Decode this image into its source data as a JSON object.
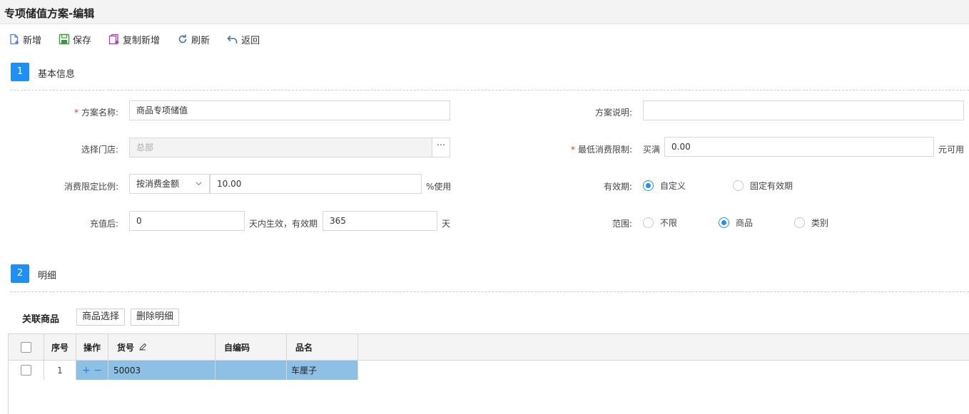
{
  "page": {
    "title": "专项储值方案-编辑"
  },
  "toolbar": {
    "new_label": "新增",
    "save_label": "保存",
    "copy_new_label": "复制新增",
    "refresh_label": "刷新",
    "back_label": "返回"
  },
  "section1": {
    "num": "1",
    "title": "基本信息"
  },
  "form": {
    "plan_name_label": "方案名称:",
    "plan_name_value": "商品专项储值",
    "plan_desc_label": "方案说明:",
    "plan_desc_value": "",
    "store_label": "选择门店:",
    "store_value": "总部",
    "store_more": "···",
    "min_consume_label": "最低消费限制:",
    "min_consume_prefix": "买满",
    "min_consume_value": "0.00",
    "min_consume_suffix": "元可用",
    "ratio_label": "消费限定比例:",
    "ratio_select": "按消费金额",
    "ratio_value": "10.00",
    "ratio_suffix": "%使用",
    "validity_label": "有效期:",
    "validity_options": [
      "自定义",
      "固定有效期"
    ],
    "validity_selected": 0,
    "recharge_label": "充值后:",
    "recharge_value": "0",
    "recharge_mid": "天内生效，有效期",
    "recharge_days": "365",
    "recharge_suffix": "天",
    "scope_label": "范围:",
    "scope_options": [
      "不限",
      "商品",
      "类别"
    ],
    "scope_selected": 1
  },
  "section2": {
    "num": "2",
    "title": "明细"
  },
  "detail": {
    "label": "关联商品",
    "select_btn": "商品选择",
    "delete_btn": "删除明细"
  },
  "table": {
    "headers": [
      "序号",
      "操作",
      "货号",
      "自编码",
      "品名"
    ],
    "rows": [
      {
        "seq": "1",
        "ops": "+ −",
        "code": "50003",
        "self_code": "",
        "name": "车厘子"
      }
    ]
  },
  "colors": {
    "accent": "#1e90f5",
    "row_highlight": "#8ec0e6",
    "required": "#e53030"
  }
}
